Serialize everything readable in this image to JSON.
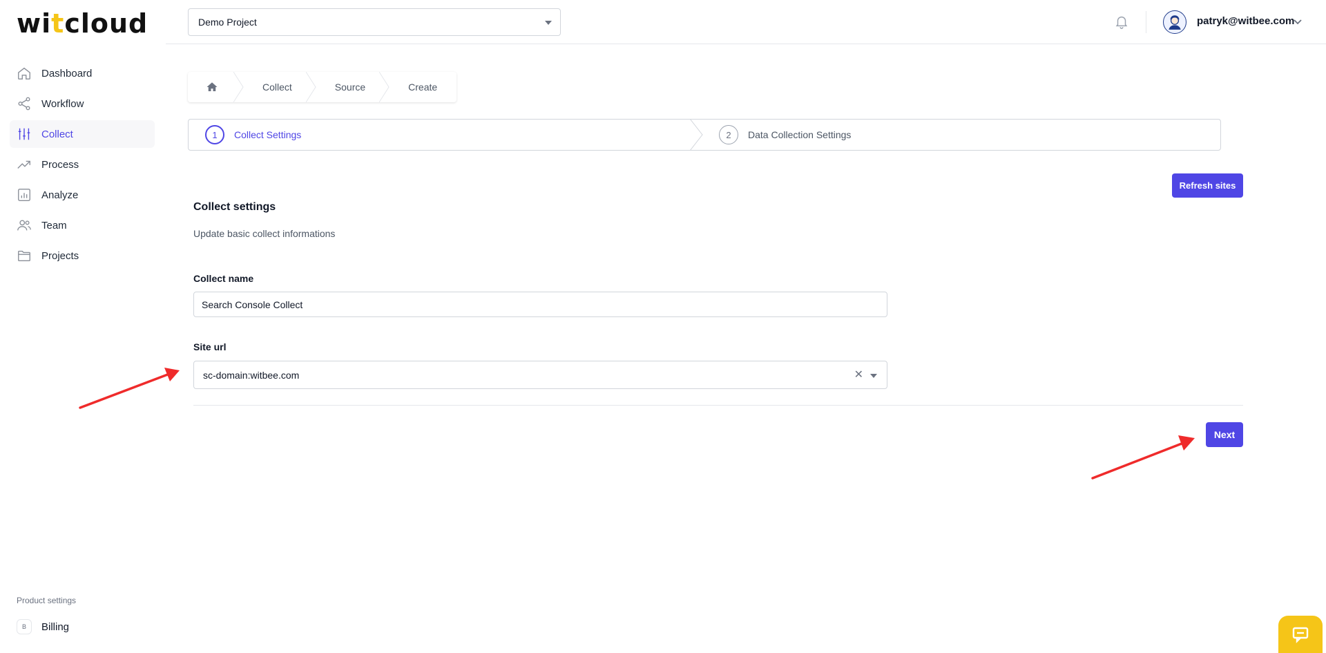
{
  "app": {
    "logo": {
      "prefix": "wi",
      "accent": "t",
      "suffix": "cloud"
    },
    "brand_color": "#4f46e5",
    "accent_color": "#f5c518"
  },
  "sidebar": {
    "items": [
      {
        "label": "Dashboard",
        "icon": "home-icon",
        "active": false
      },
      {
        "label": "Workflow",
        "icon": "share-icon",
        "active": false
      },
      {
        "label": "Collect",
        "icon": "sliders-icon",
        "active": true
      },
      {
        "label": "Process",
        "icon": "trending-up-icon",
        "active": false
      },
      {
        "label": "Analyze",
        "icon": "bar-chart-icon",
        "active": false
      },
      {
        "label": "Team",
        "icon": "users-icon",
        "active": false
      },
      {
        "label": "Projects",
        "icon": "folder-icon",
        "active": false
      }
    ],
    "product_settings_label": "Product settings",
    "billing": {
      "badge": "B",
      "label": "Billing"
    }
  },
  "topbar": {
    "project": "Demo Project",
    "user_email": "patryk@witbee.com"
  },
  "breadcrumb": {
    "items": [
      "Collect",
      "Source",
      "Create"
    ]
  },
  "stepper": {
    "steps": [
      {
        "number": "1",
        "label": "Collect Settings",
        "active": true
      },
      {
        "number": "2",
        "label": "Data Collection Settings",
        "active": false
      }
    ]
  },
  "form": {
    "refresh_label": "Refresh sites",
    "title": "Collect settings",
    "description": "Update basic collect informations",
    "collect_name_label": "Collect name",
    "collect_name_value": "Search Console Collect",
    "site_url_label": "Site url",
    "site_url_value": "sc-domain:witbee.com",
    "clear_symbol": "✕",
    "next_label": "Next"
  }
}
